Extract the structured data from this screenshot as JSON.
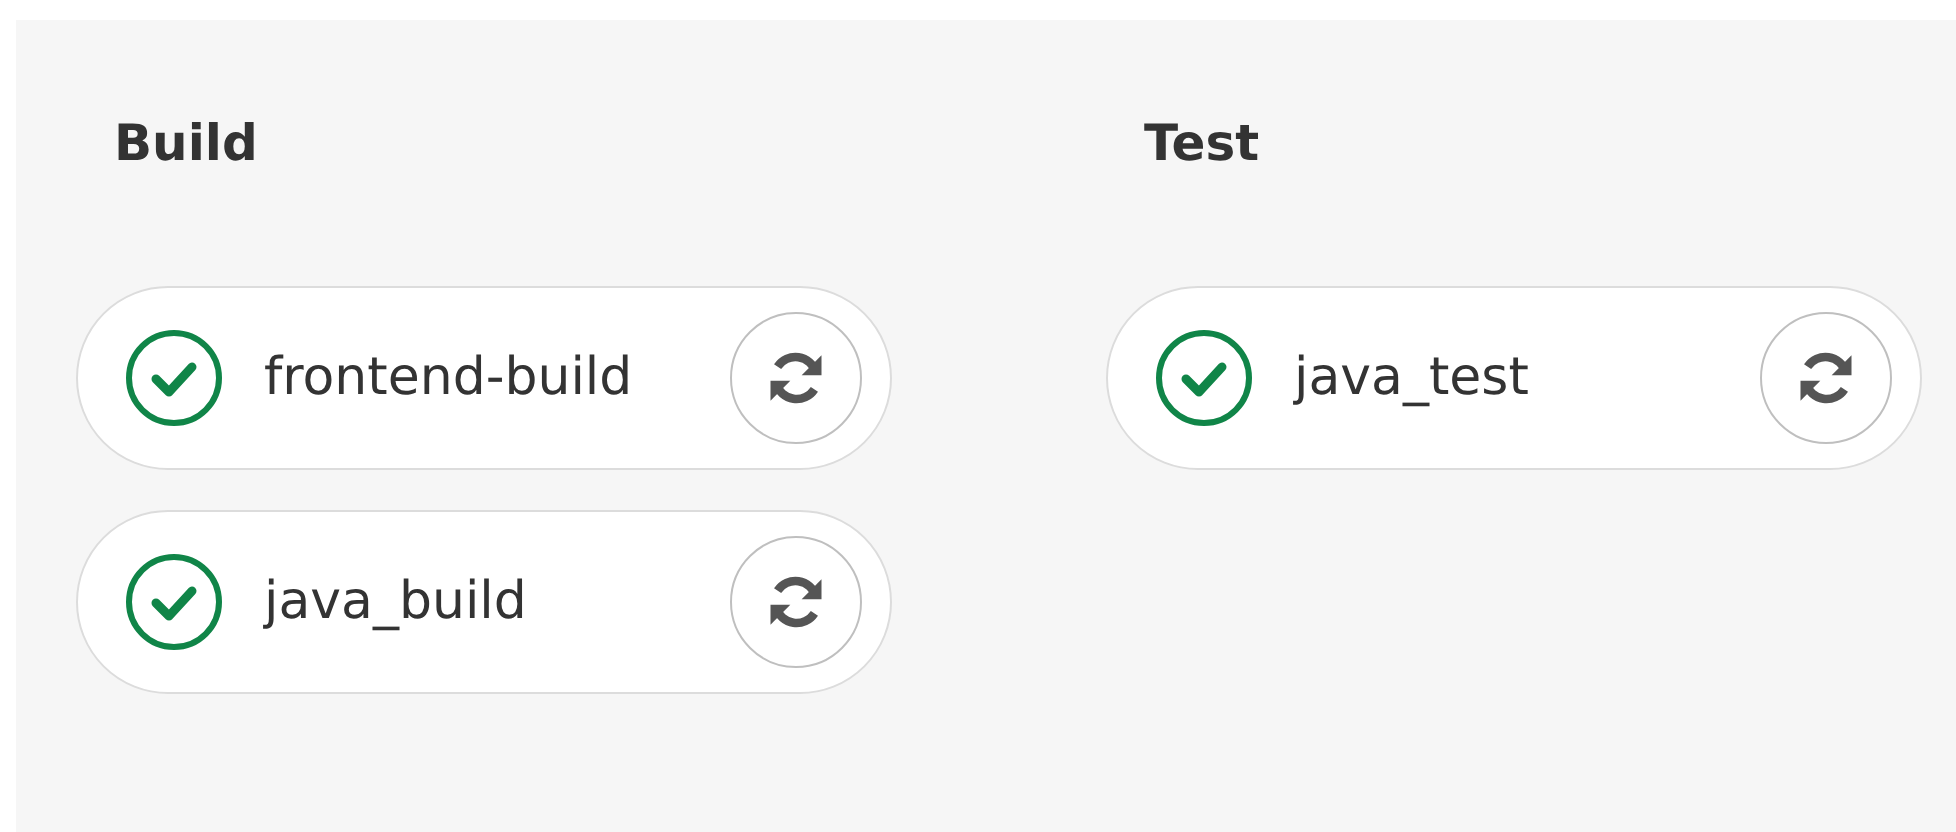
{
  "stages": [
    {
      "title": "Build",
      "jobs": [
        {
          "name": "frontend-build",
          "kind": "success"
        },
        {
          "name": "java_build",
          "kind": "success"
        }
      ]
    },
    {
      "title": "Test",
      "jobs": [
        {
          "name": "java_test",
          "kind": "success"
        }
      ]
    }
  ]
}
